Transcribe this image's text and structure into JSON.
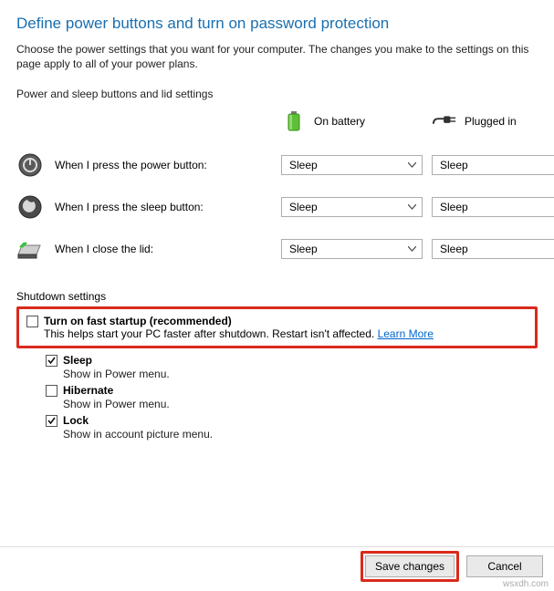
{
  "title": "Define power buttons and turn on password protection",
  "subtitle": "Choose the power settings that you want for your computer. The changes you make to the settings on this page apply to all of your power plans.",
  "section_buttons_label": "Power and sleep buttons and lid settings",
  "columns": {
    "battery": "On battery",
    "plugged": "Plugged in"
  },
  "rows": {
    "power": {
      "label": "When I press the power button:",
      "battery": "Sleep",
      "plugged": "Sleep"
    },
    "sleep": {
      "label": "When I press the sleep button:",
      "battery": "Sleep",
      "plugged": "Sleep"
    },
    "lid": {
      "label": "When I close the lid:",
      "battery": "Sleep",
      "plugged": "Sleep"
    }
  },
  "shutdown_label": "Shutdown settings",
  "fast_startup": {
    "title": "Turn on fast startup (recommended)",
    "desc": "This helps start your PC faster after shutdown. Restart isn't affected. ",
    "link": "Learn More",
    "checked": false
  },
  "options": {
    "sleep": {
      "title": "Sleep",
      "desc": "Show in Power menu.",
      "checked": true
    },
    "hibernate": {
      "title": "Hibernate",
      "desc": "Show in Power menu.",
      "checked": false
    },
    "lock": {
      "title": "Lock",
      "desc": "Show in account picture menu.",
      "checked": true
    }
  },
  "buttons": {
    "save": "Save changes",
    "cancel": "Cancel"
  },
  "watermark": "wsxdh.com"
}
